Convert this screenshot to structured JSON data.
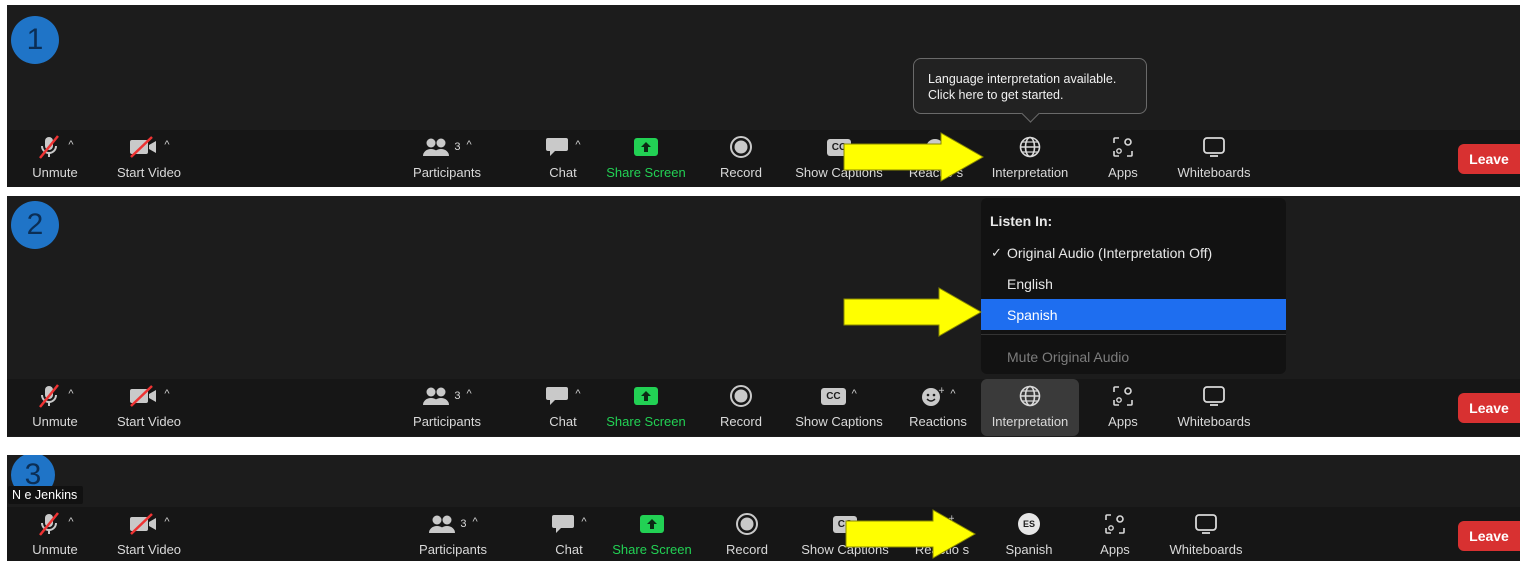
{
  "steps": [
    "1",
    "2",
    "3"
  ],
  "toolbar": {
    "unmute": "Unmute",
    "start_video": "Start Video",
    "participants": "Participants",
    "participant_count": "3",
    "chat": "Chat",
    "share_screen": "Share Screen",
    "record": "Record",
    "show_captions": "Show Captions",
    "cc_icon_text": "CC",
    "reactions_cut": "Reactio s",
    "reactions": "Reactions",
    "interpretation": "Interpretation",
    "apps": "Apps",
    "whiteboards": "Whiteboards",
    "leave": "Leave",
    "spanish": "Spanish",
    "es_badge": "ES"
  },
  "tooltip": {
    "line1": "Language interpretation available.",
    "line2": "Click here to get started."
  },
  "listen_menu": {
    "header": "Listen In:",
    "check": "✓",
    "items": [
      "Original Audio (Interpretation Off)",
      "English",
      "Spanish",
      "Mute Original Audio"
    ],
    "selected": "Spanish"
  },
  "participant_name_tag": "N   e Jenkins",
  "colors": {
    "panel_bg": "#1c1c1c",
    "share_green": "#22d154",
    "leave_red": "#d83131",
    "selected_blue": "#1e6ef0",
    "step_badge_blue": "#1f74c7",
    "arrow_yellow": "#ffff00"
  }
}
